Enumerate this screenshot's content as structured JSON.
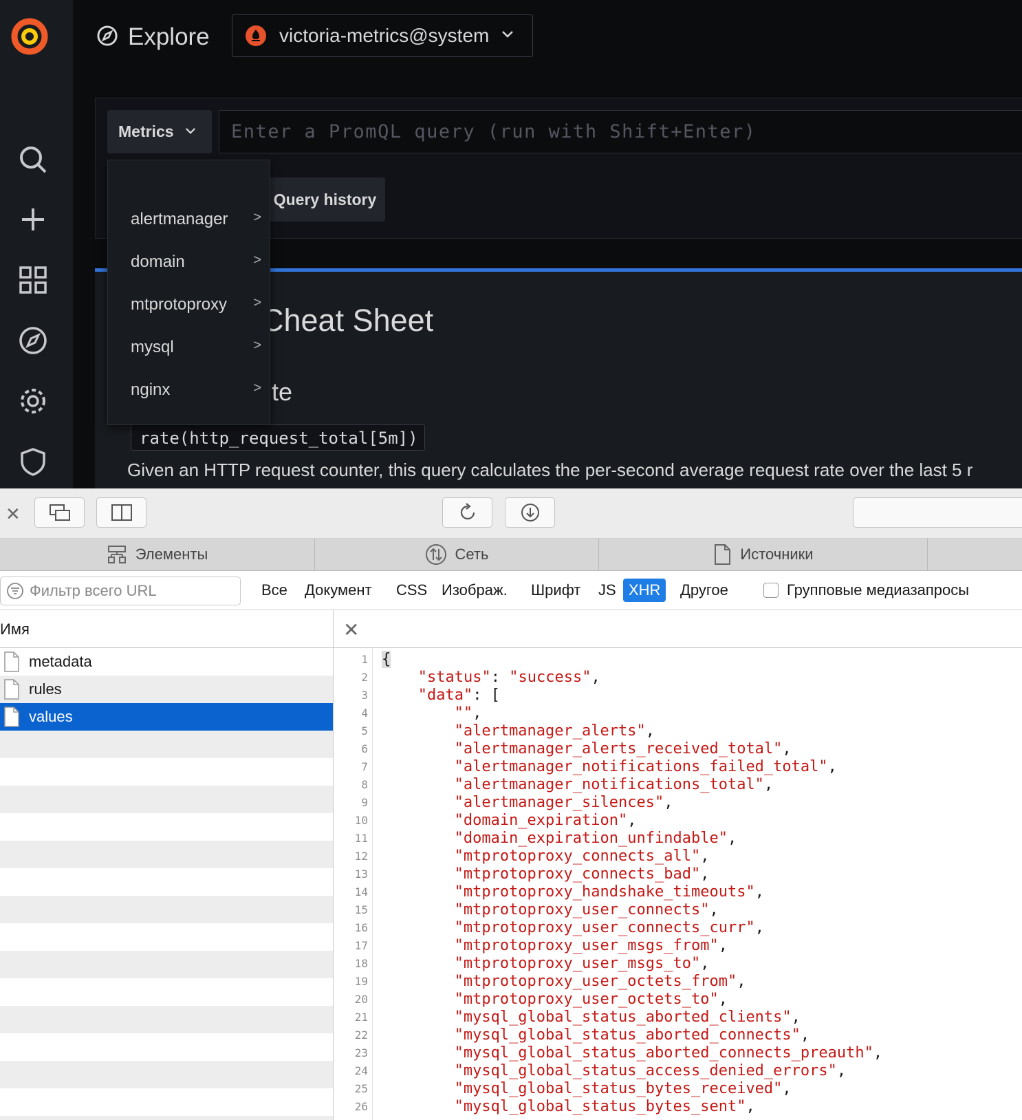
{
  "grafana": {
    "title": "Explore",
    "datasource": "victoria-metrics@system",
    "metrics_button": "Metrics",
    "query_placeholder": "Enter a PromQL query (run with Shift+Enter)",
    "query_history": "Query history",
    "cheat_sheet_title": "Cheat Sheet",
    "cheat_sheet_subtitle": "te",
    "cheat_sheet_code": "rate(http_request_total[5m])",
    "cheat_sheet_description": "Given an HTTP request counter, this query calculates the per-second average request rate over the last 5 r",
    "metrics_menu": [
      {
        "label": "alertmanager",
        "arrow": ">"
      },
      {
        "label": "domain",
        "arrow": ">"
      },
      {
        "label": "mtprotoproxy",
        "arrow": ">"
      },
      {
        "label": "mysql",
        "arrow": ">"
      },
      {
        "label": "nginx",
        "arrow": ">"
      }
    ],
    "colors": {
      "accent": "#3274d9",
      "logo": "#f05a28"
    }
  },
  "devtools": {
    "tabs": [
      {
        "label": "Элементы",
        "icon": "elements-icon"
      },
      {
        "label": "Сеть",
        "icon": "network-icon"
      },
      {
        "label": "Источники",
        "icon": "document-icon"
      }
    ],
    "filter_placeholder": "Фильтр всего URL",
    "type_filters": [
      {
        "label": "Все",
        "active": false
      },
      {
        "label": "Документ",
        "active": false
      },
      {
        "label": "CSS",
        "active": false
      },
      {
        "label": "Изображ.",
        "active": false
      },
      {
        "label": "Шрифт",
        "active": false
      },
      {
        "label": "JS",
        "active": false
      },
      {
        "label": "XHR",
        "active": true
      },
      {
        "label": "Другое",
        "active": false
      }
    ],
    "group_media_label": "Групповые медиазапросы",
    "name_column": "Имя",
    "requests": [
      {
        "name": "metadata",
        "selected": false
      },
      {
        "name": "rules",
        "selected": false
      },
      {
        "name": "values",
        "selected": true
      }
    ],
    "response_lines": [
      {
        "n": "1",
        "indent": 0,
        "parts": [
          [
            "p",
            "{"
          ]
        ]
      },
      {
        "n": "2",
        "indent": 1,
        "parts": [
          [
            "s",
            "\"status\""
          ],
          [
            "p",
            ": "
          ],
          [
            "s",
            "\"success\""
          ],
          [
            "p",
            ","
          ]
        ]
      },
      {
        "n": "3",
        "indent": 1,
        "parts": [
          [
            "s",
            "\"data\""
          ],
          [
            "p",
            ": ["
          ]
        ]
      },
      {
        "n": "4",
        "indent": 2,
        "parts": [
          [
            "s",
            "\"\""
          ],
          [
            "p",
            ","
          ]
        ]
      },
      {
        "n": "5",
        "indent": 2,
        "parts": [
          [
            "s",
            "\"alertmanager_alerts\""
          ],
          [
            "p",
            ","
          ]
        ]
      },
      {
        "n": "6",
        "indent": 2,
        "parts": [
          [
            "s",
            "\"alertmanager_alerts_received_total\""
          ],
          [
            "p",
            ","
          ]
        ]
      },
      {
        "n": "7",
        "indent": 2,
        "parts": [
          [
            "s",
            "\"alertmanager_notifications_failed_total\""
          ],
          [
            "p",
            ","
          ]
        ]
      },
      {
        "n": "8",
        "indent": 2,
        "parts": [
          [
            "s",
            "\"alertmanager_notifications_total\""
          ],
          [
            "p",
            ","
          ]
        ]
      },
      {
        "n": "9",
        "indent": 2,
        "parts": [
          [
            "s",
            "\"alertmanager_silences\""
          ],
          [
            "p",
            ","
          ]
        ]
      },
      {
        "n": "10",
        "indent": 2,
        "parts": [
          [
            "s",
            "\"domain_expiration\""
          ],
          [
            "p",
            ","
          ]
        ]
      },
      {
        "n": "11",
        "indent": 2,
        "parts": [
          [
            "s",
            "\"domain_expiration_unfindable\""
          ],
          [
            "p",
            ","
          ]
        ]
      },
      {
        "n": "12",
        "indent": 2,
        "parts": [
          [
            "s",
            "\"mtprotoproxy_connects_all\""
          ],
          [
            "p",
            ","
          ]
        ]
      },
      {
        "n": "13",
        "indent": 2,
        "parts": [
          [
            "s",
            "\"mtprotoproxy_connects_bad\""
          ],
          [
            "p",
            ","
          ]
        ]
      },
      {
        "n": "14",
        "indent": 2,
        "parts": [
          [
            "s",
            "\"mtprotoproxy_handshake_timeouts\""
          ],
          [
            "p",
            ","
          ]
        ]
      },
      {
        "n": "15",
        "indent": 2,
        "parts": [
          [
            "s",
            "\"mtprotoproxy_user_connects\""
          ],
          [
            "p",
            ","
          ]
        ]
      },
      {
        "n": "16",
        "indent": 2,
        "parts": [
          [
            "s",
            "\"mtprotoproxy_user_connects_curr\""
          ],
          [
            "p",
            ","
          ]
        ]
      },
      {
        "n": "17",
        "indent": 2,
        "parts": [
          [
            "s",
            "\"mtprotoproxy_user_msgs_from\""
          ],
          [
            "p",
            ","
          ]
        ]
      },
      {
        "n": "18",
        "indent": 2,
        "parts": [
          [
            "s",
            "\"mtprotoproxy_user_msgs_to\""
          ],
          [
            "p",
            ","
          ]
        ]
      },
      {
        "n": "19",
        "indent": 2,
        "parts": [
          [
            "s",
            "\"mtprotoproxy_user_octets_from\""
          ],
          [
            "p",
            ","
          ]
        ]
      },
      {
        "n": "20",
        "indent": 2,
        "parts": [
          [
            "s",
            "\"mtprotoproxy_user_octets_to\""
          ],
          [
            "p",
            ","
          ]
        ]
      },
      {
        "n": "21",
        "indent": 2,
        "parts": [
          [
            "s",
            "\"mysql_global_status_aborted_clients\""
          ],
          [
            "p",
            ","
          ]
        ]
      },
      {
        "n": "22",
        "indent": 2,
        "parts": [
          [
            "s",
            "\"mysql_global_status_aborted_connects\""
          ],
          [
            "p",
            ","
          ]
        ]
      },
      {
        "n": "23",
        "indent": 2,
        "parts": [
          [
            "s",
            "\"mysql_global_status_aborted_connects_preauth\""
          ],
          [
            "p",
            ","
          ]
        ]
      },
      {
        "n": "24",
        "indent": 2,
        "parts": [
          [
            "s",
            "\"mysql_global_status_access_denied_errors\""
          ],
          [
            "p",
            ","
          ]
        ]
      },
      {
        "n": "25",
        "indent": 2,
        "parts": [
          [
            "s",
            "\"mysql_global_status_bytes_received\""
          ],
          [
            "p",
            ","
          ]
        ]
      },
      {
        "n": "26",
        "indent": 2,
        "parts": [
          [
            "s",
            "\"mysql_global_status_bytes_sent\""
          ],
          [
            "p",
            ","
          ]
        ]
      }
    ],
    "colors": {
      "string": "#c41a16",
      "selected_row": "#0b63d0",
      "active_filter": "#1f7ee6"
    }
  }
}
